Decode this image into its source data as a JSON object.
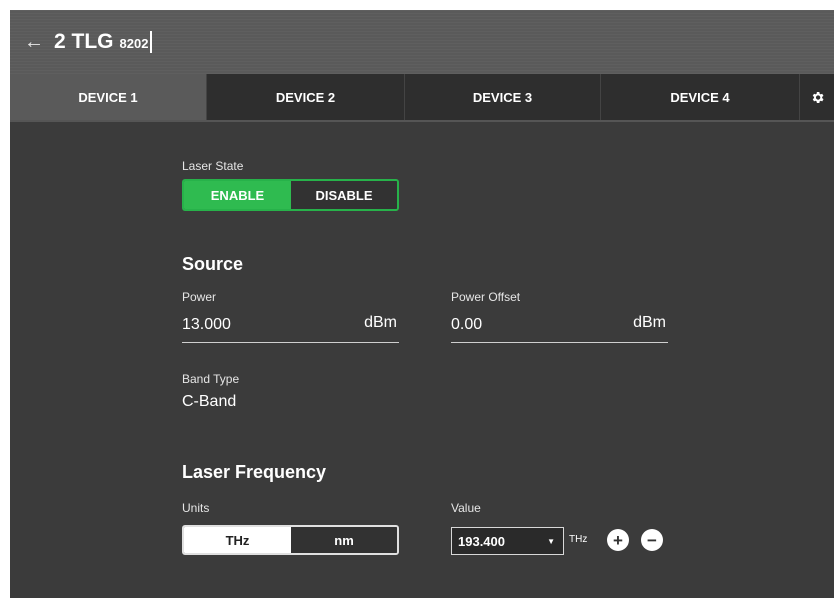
{
  "header": {
    "back_icon": "←",
    "title": "2 TLG",
    "model": "8202"
  },
  "tabs": [
    {
      "label": "DEVICE 1",
      "active": true
    },
    {
      "label": "DEVICE 2",
      "active": false
    },
    {
      "label": "DEVICE 3",
      "active": false
    },
    {
      "label": "DEVICE 4",
      "active": false
    }
  ],
  "laser_state": {
    "label": "Laser State",
    "enable_label": "ENABLE",
    "disable_label": "DISABLE",
    "selected": "ENABLE"
  },
  "source": {
    "title": "Source",
    "power": {
      "label": "Power",
      "value": "13.000",
      "unit": "dBm"
    },
    "power_offset": {
      "label": "Power Offset",
      "value": "0.00",
      "unit": "dBm"
    },
    "band_type": {
      "label": "Band Type",
      "value": "C-Band"
    }
  },
  "laser_frequency": {
    "title": "Laser Frequency",
    "units_label": "Units",
    "units_options": [
      "THz",
      "nm"
    ],
    "units_selected": "THz",
    "value_label": "Value",
    "value": "193.400",
    "value_unit": "THz",
    "increment_label": "+",
    "decrement_label": "−"
  },
  "colors": {
    "accent_green": "#2fbb50",
    "background": "#3b3b3b",
    "header": "#5a5a5a"
  }
}
